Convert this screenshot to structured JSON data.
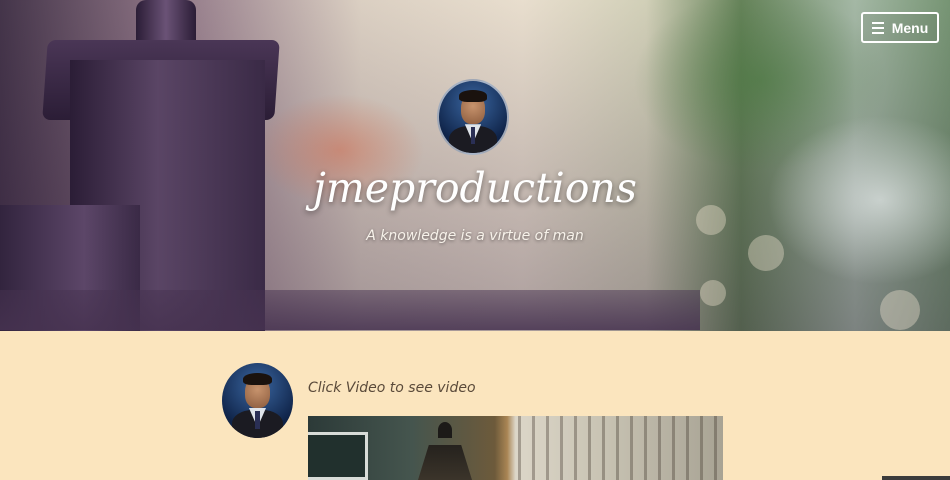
{
  "header": {
    "menu_label": "Menu",
    "site_title": "jmeproductions",
    "tagline": "A knowledge is a virtue of man"
  },
  "post": {
    "text": "Click Video to see video"
  },
  "colors": {
    "page_background": "#fbe5be",
    "title_text": "#ffffff",
    "post_text": "#5a4a3a"
  },
  "icons": {
    "menu": "hamburger-icon"
  }
}
